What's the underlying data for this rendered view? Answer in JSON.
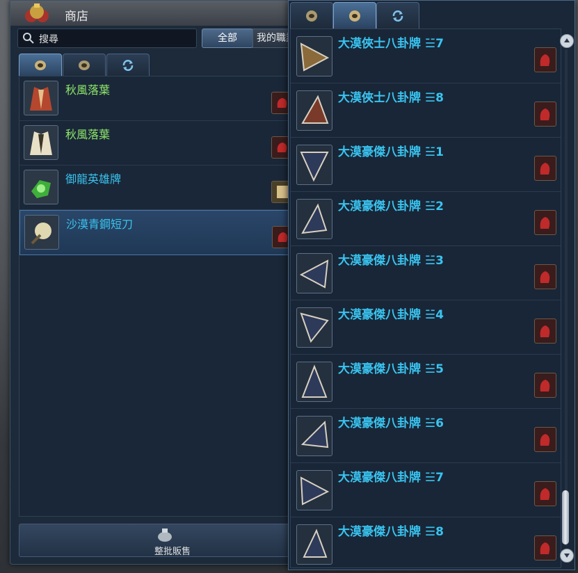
{
  "shop": {
    "title": "商店",
    "search_text": "搜尋",
    "filter_all": "全部",
    "filter_mine": "我的職業",
    "bulk_sell_label": "整批販售",
    "items": [
      {
        "name": "秋風落葉",
        "color": "#8ee86a"
      },
      {
        "name": "秋風落葉",
        "color": "#8ee86a"
      },
      {
        "name": "御龍英雄牌",
        "color": "#39c4f0"
      },
      {
        "name": "沙漠青鋼短刀",
        "color": "#39c4f0"
      }
    ]
  },
  "rpanel": {
    "items": [
      {
        "name": "大漠俠士八卦牌 ☱7"
      },
      {
        "name": "大漠俠士八卦牌 ☰8"
      },
      {
        "name": "大漠豪傑八卦牌 ☱1"
      },
      {
        "name": "大漠豪傑八卦牌 ☱2"
      },
      {
        "name": "大漠豪傑八卦牌 ☱3"
      },
      {
        "name": "大漠豪傑八卦牌 ☱4"
      },
      {
        "name": "大漠豪傑八卦牌 ☱5"
      },
      {
        "name": "大漠豪傑八卦牌 ☱6"
      },
      {
        "name": "大漠豪傑八卦牌 ☱7"
      },
      {
        "name": "大漠豪傑八卦牌 ☰8"
      }
    ]
  },
  "colors": {
    "legend_text": "#39c4f0",
    "uncommon_text": "#8ee86a"
  }
}
